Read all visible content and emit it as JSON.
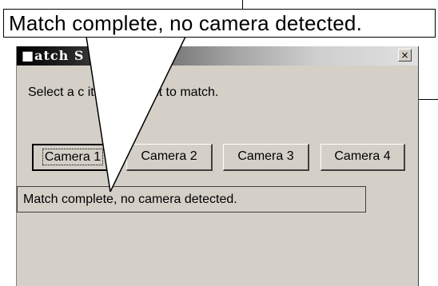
{
  "callout": {
    "text": "Match complete, no camera detected."
  },
  "dialog": {
    "title": "■atch S",
    "close_label": "×",
    "prompt": "Select a c            itch you want to match.",
    "buttons": [
      {
        "label": "Camera 1",
        "default": true
      },
      {
        "label": "Camera 2"
      },
      {
        "label": "Camera 3"
      },
      {
        "label": "Camera 4"
      }
    ],
    "status": "Match complete, no camera detected."
  }
}
